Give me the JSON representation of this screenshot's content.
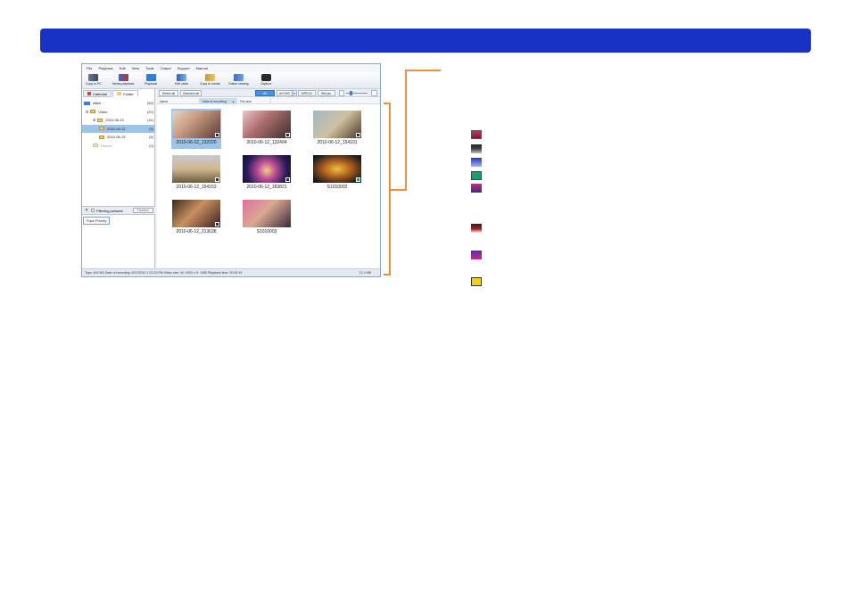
{
  "menu": [
    "File",
    "Playback",
    "Edit",
    "View",
    "Tools",
    "Output",
    "Support",
    "Manual"
  ],
  "toolbar": [
    {
      "label": "Copy to PC",
      "icon": "copy-to-pc-icon"
    },
    {
      "label": "Media playback",
      "icon": "media-playback-icon"
    },
    {
      "label": "Playback",
      "icon": "playback-icon"
    },
    {
      "label": "Edit video",
      "icon": "edit-video-icon"
    },
    {
      "label": "Copy to media",
      "icon": "copy-to-media-icon"
    },
    {
      "label": "Online sharing",
      "icon": "online-sharing-icon"
    },
    {
      "label": "Capture",
      "icon": "capture-icon"
    }
  ],
  "left_tabs": {
    "calendar": "Calendar",
    "folder": "Folder"
  },
  "tree": [
    {
      "label": "sfiles",
      "count": "(65)"
    },
    {
      "label": "Video",
      "count": "(20)"
    },
    {
      "label": "2010-06-10",
      "count": "(16)"
    },
    {
      "label": "2010-06-12",
      "count": "(8)"
    },
    {
      "label": "2010-06-13",
      "count": "(8)"
    },
    {
      "label": "Picture",
      "count": "(0)"
    }
  ],
  "filter": {
    "label": "Filtering pictures",
    "button": "Function"
  },
  "face_tab": "Face Priority",
  "action_bar": {
    "select_all": "Select all",
    "deselect_all": "Deselect all",
    "all": "All",
    "avchd": "AVCHD",
    "mpeg2": "MPEG2",
    "still": "Still pic."
  },
  "columns": {
    "name": "Name",
    "date": "Date of recording",
    "size": "File size"
  },
  "thumbnails": [
    "2010-06-12_132220",
    "2010-06-12_132404",
    "2010-06-12_154101",
    "2010-06-12_154153",
    "2010-06-12_183821",
    "S1010002",
    "2010-06-12_213628",
    "S1010003"
  ],
  "status": {
    "text": "Type: AVCHD  Date of recording: 6/12/2010 1:22:20 PM  Video size: W: 1920 x H: 1080  Playback time: 00:00:15",
    "size": "12.4 MB"
  },
  "colors": {
    "banner": "#1832c4",
    "bracket": "#f08c3c",
    "selection": "#9cc3ea"
  }
}
